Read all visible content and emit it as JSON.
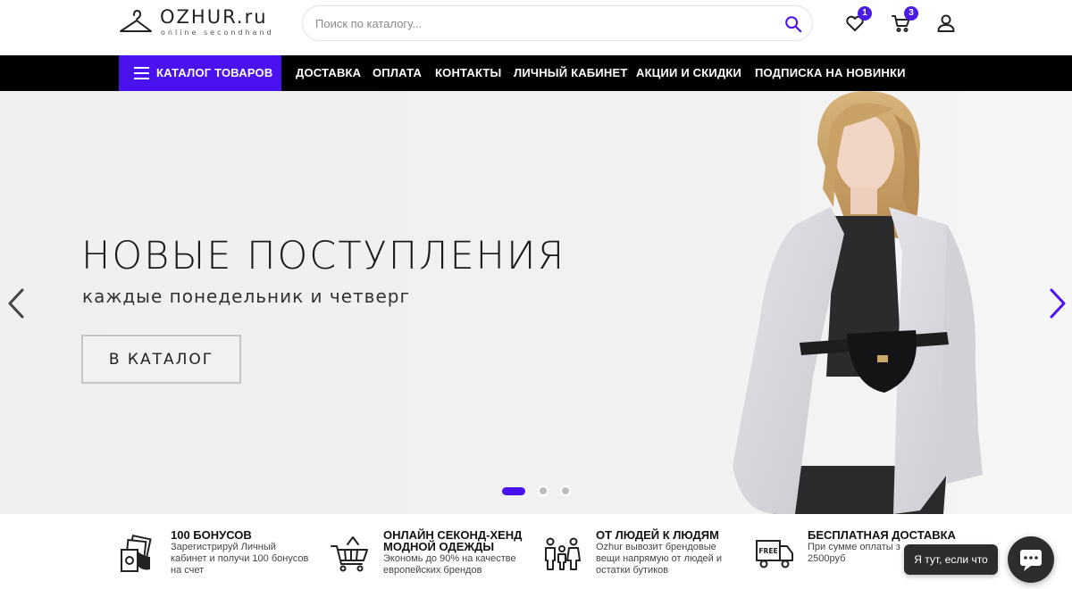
{
  "header": {
    "logo_text": "OZHUR.ru",
    "logo_sub": "online secondhand",
    "search_placeholder": "Поиск по каталогу...",
    "icons": {
      "logo": "hanger-icon",
      "search": "search-icon",
      "favorites": "heart-icon",
      "cart": "cart-icon",
      "account": "user-icon"
    },
    "favorites_count": "1",
    "cart_count": "3"
  },
  "nav": {
    "catalog_label": "КАТАЛОГ ТОВАРОВ",
    "links": [
      "ДОСТАВКА",
      "ОПЛАТА",
      "КОНТАКТЫ",
      "ЛИЧНЫЙ КАБИНЕТ",
      "АКЦИИ И СКИДКИ",
      "ПОДПИСКА НА НОВИНКИ"
    ]
  },
  "hero": {
    "title": "НОВЫЕ ПОСТУПЛЕНИЯ",
    "subtitle": "каждые понедельник и четверг",
    "button_label": "В КАТАЛОГ",
    "slide_count": 3,
    "active_slide": 1
  },
  "features": [
    {
      "icon": "bonus-cash-icon",
      "title": "100 БОНУСОВ",
      "text": [
        "Зарегистрируй Личный",
        "кабинет и получи 100 бонусов",
        "на счет"
      ]
    },
    {
      "icon": "shopping-basket-icon",
      "title": [
        "ОНЛАЙН СЕКОНД-ХЕНД",
        "МОДНОЙ ОДЕЖДЫ"
      ],
      "text": [
        "Экономь до 90% на качестве",
        "европейских брендов"
      ]
    },
    {
      "icon": "family-icon",
      "title": "ОТ ЛЮДЕЙ К ЛЮДЯМ",
      "text": [
        "Ozhur вывозит брендовые",
        "вещи напрямую от людей и",
        "остатки бутиков"
      ]
    },
    {
      "icon": "free-delivery-truck-icon",
      "title": "БЕСПЛАТНАЯ ДОСТАВКА",
      "text": [
        "При сумме оплаты з",
        "2500руб"
      ]
    }
  ],
  "chat": {
    "bubble_text": "Я тут, если что",
    "icon": "chat-icon"
  },
  "colors": {
    "accent": "#4b12f0",
    "nav_bg": "#000000",
    "hero_bg": "#efeff0"
  }
}
